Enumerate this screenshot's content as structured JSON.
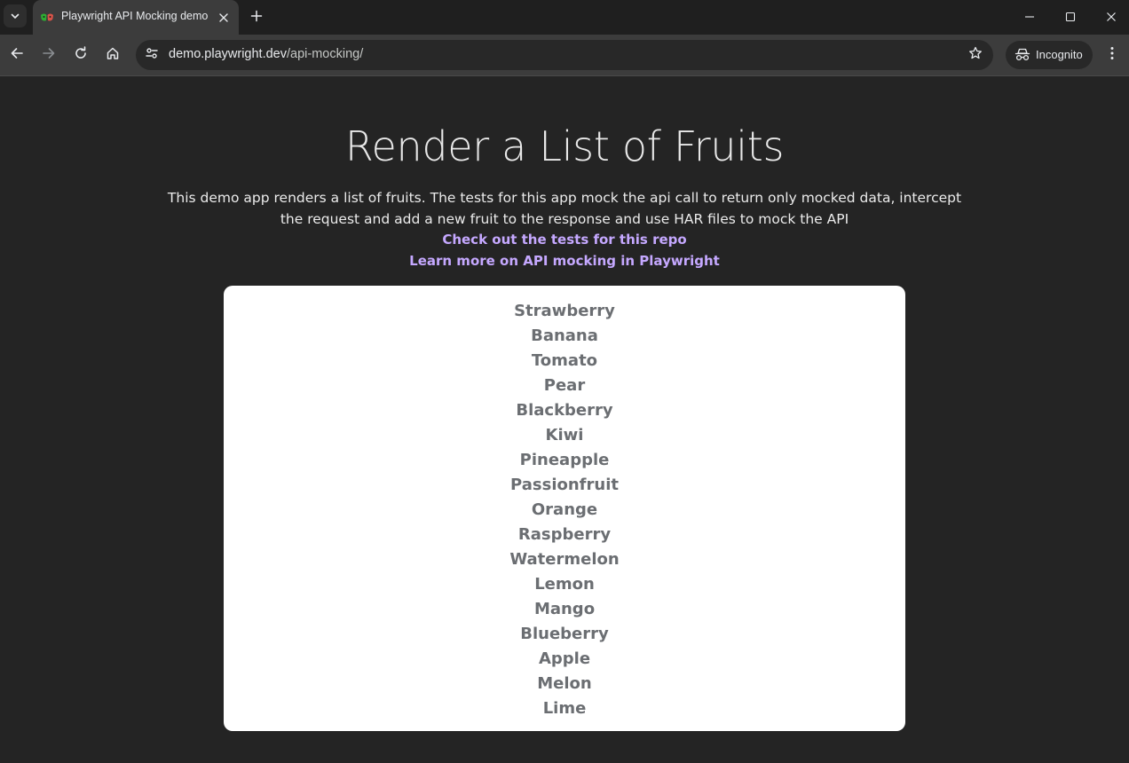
{
  "browser": {
    "tab": {
      "title": "Playwright API Mocking demo"
    },
    "address_bar": {
      "host": "demo.playwright.dev",
      "path": "/api-mocking/"
    },
    "profile_label": "Incognito",
    "theme": {
      "tabstrip_bg": "#1f1f1f",
      "toolbar_bg": "#3c3c3c",
      "page_bg": "#242424",
      "link_color": "#c5a8ff"
    }
  },
  "page": {
    "title": "Render a List of Fruits",
    "description": "This demo app renders a list of fruits. The tests for this app mock the api call to return only mocked data, intercept the request and add a new fruit to the response and use HAR files to mock the API",
    "links": [
      {
        "label": "Check out the tests for this repo"
      },
      {
        "label": "Learn more on API mocking in Playwright"
      }
    ],
    "fruits": [
      "Strawberry",
      "Banana",
      "Tomato",
      "Pear",
      "Blackberry",
      "Kiwi",
      "Pineapple",
      "Passionfruit",
      "Orange",
      "Raspberry",
      "Watermelon",
      "Lemon",
      "Mango",
      "Blueberry",
      "Apple",
      "Melon",
      "Lime"
    ]
  }
}
